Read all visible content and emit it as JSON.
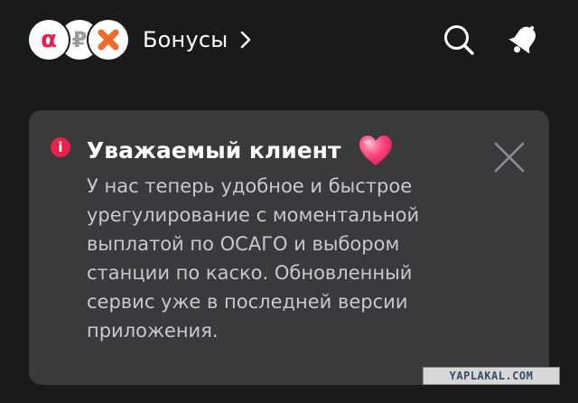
{
  "header": {
    "coins": [
      {
        "icon": "alfa-logo-icon",
        "glyph": "α",
        "color": "#e8214b"
      },
      {
        "icon": "ruble-icon",
        "glyph": "₽",
        "color": "#9a9a9a"
      },
      {
        "icon": "x-logo-icon",
        "color": "#f06a2a"
      }
    ],
    "bonus_label": "Бонусы",
    "search_icon": "search-icon",
    "bell_icon": "bell-icon"
  },
  "notification": {
    "icon": "info-icon",
    "icon_glyph": "i",
    "icon_color": "#e8214b",
    "title": "Уважаемый клиент",
    "title_emoji": "heart-icon",
    "body_lines": [
      "У нас теперь удобное и быстрое",
      "урегулирование с моментальной",
      "выплатой по ОСАГО и выбором",
      "станции по каско. Обновленный",
      "сервис уже в последней версии",
      "приложения."
    ],
    "close_icon": "close-icon"
  },
  "watermark": {
    "text": "YAPLAKAL.COM"
  },
  "colors": {
    "background": "#1a191b",
    "card": "#3a393c",
    "accent": "#e8214b",
    "body_text": "#c9c8cc"
  }
}
